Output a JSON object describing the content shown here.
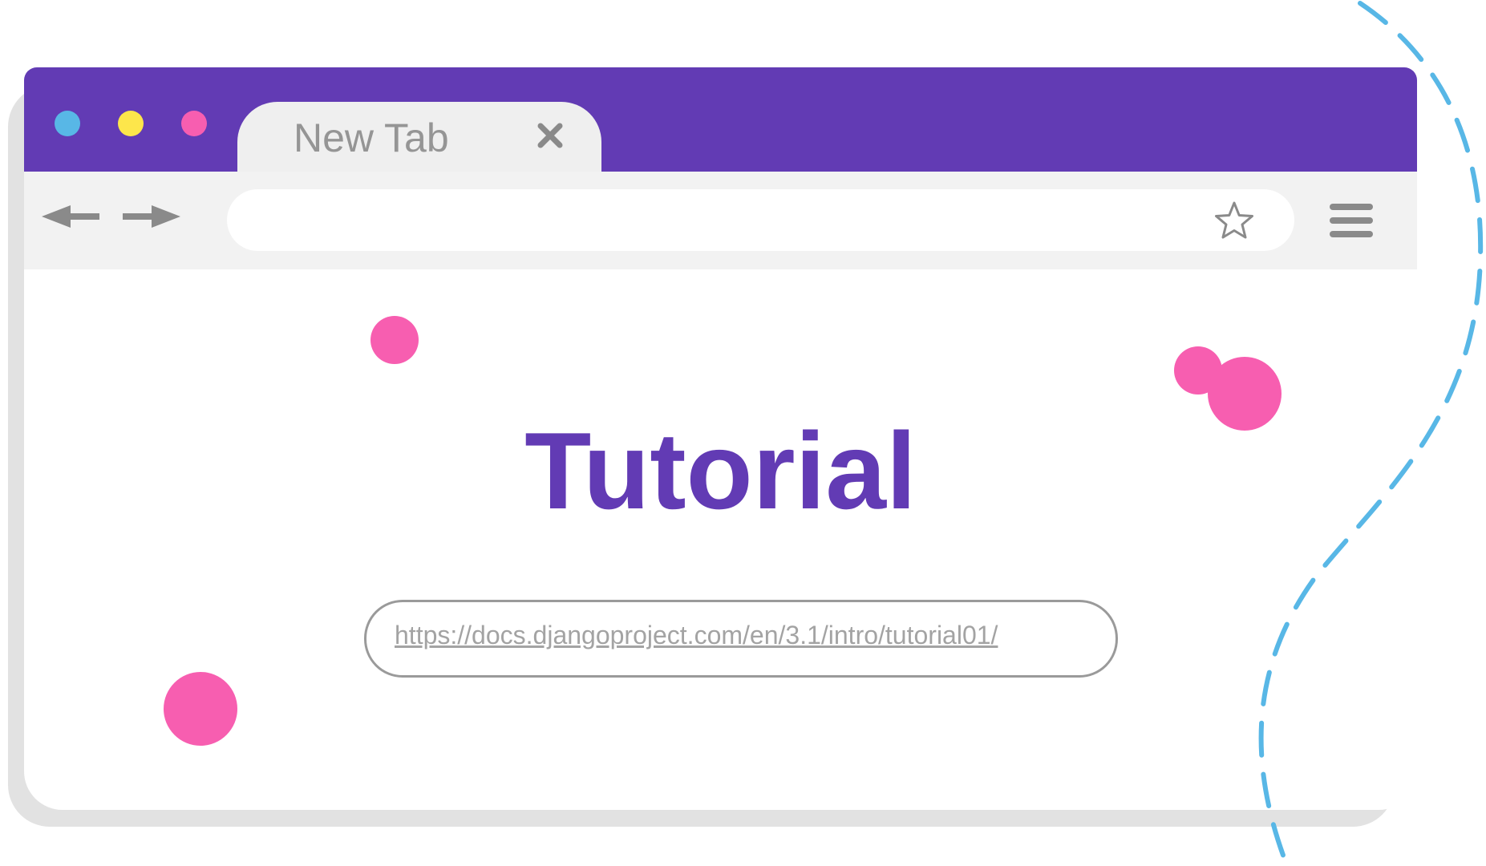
{
  "browser": {
    "window_controls": [
      "blue-dot",
      "yellow-dot",
      "pink-dot"
    ],
    "tab": {
      "label": "New Tab",
      "close_icon": "close-icon"
    },
    "toolbar": {
      "back_icon": "arrow-left-icon",
      "forward_icon": "arrow-right-icon",
      "address_value": "",
      "bookmark_icon": "star-icon",
      "menu_icon": "hamburger-menu-icon"
    }
  },
  "page": {
    "title": "Tutorial",
    "link": "https://docs.djangoproject.com/en/3.1/intro/tutorial01/"
  },
  "colors": {
    "accent_purple": "#623bb4",
    "dot_blue": "#58b7e6",
    "dot_yellow": "#fde64b",
    "dot_pink": "#f75eb0",
    "decor_dashed_line": "#58b7e6"
  }
}
